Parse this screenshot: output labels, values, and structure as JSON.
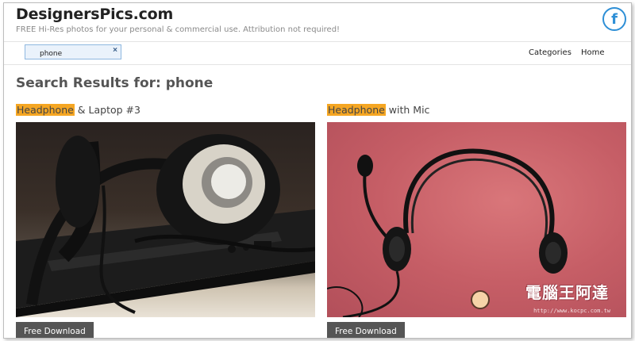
{
  "site": {
    "brand": "DesignersPics.com",
    "tagline": "FREE Hi-Res photos for your personal & commercial use. Attribution not required!",
    "facebook_icon": "f",
    "colors": {
      "accent": "#2e8fd6",
      "highlight": "#f5a623",
      "button": "#555555"
    }
  },
  "navbar": {
    "search_value": "phone",
    "clear_glyph": "×",
    "links": {
      "categories": "Categories",
      "home": "Home"
    }
  },
  "results": {
    "heading": "Search Results for: phone",
    "items": [
      {
        "title_highlight": "Headphone",
        "title_rest": " & Laptop #3",
        "image_subject": "headphone resting on laptop",
        "button": "Free Download"
      },
      {
        "title_highlight": "Headphone",
        "title_rest": " with Mic",
        "image_subject": "black headset with microphone on pink background",
        "button": "Free Download",
        "watermark": "電腦王阿達",
        "watermark_url": "http://www.kocpc.com.tw"
      }
    ]
  }
}
